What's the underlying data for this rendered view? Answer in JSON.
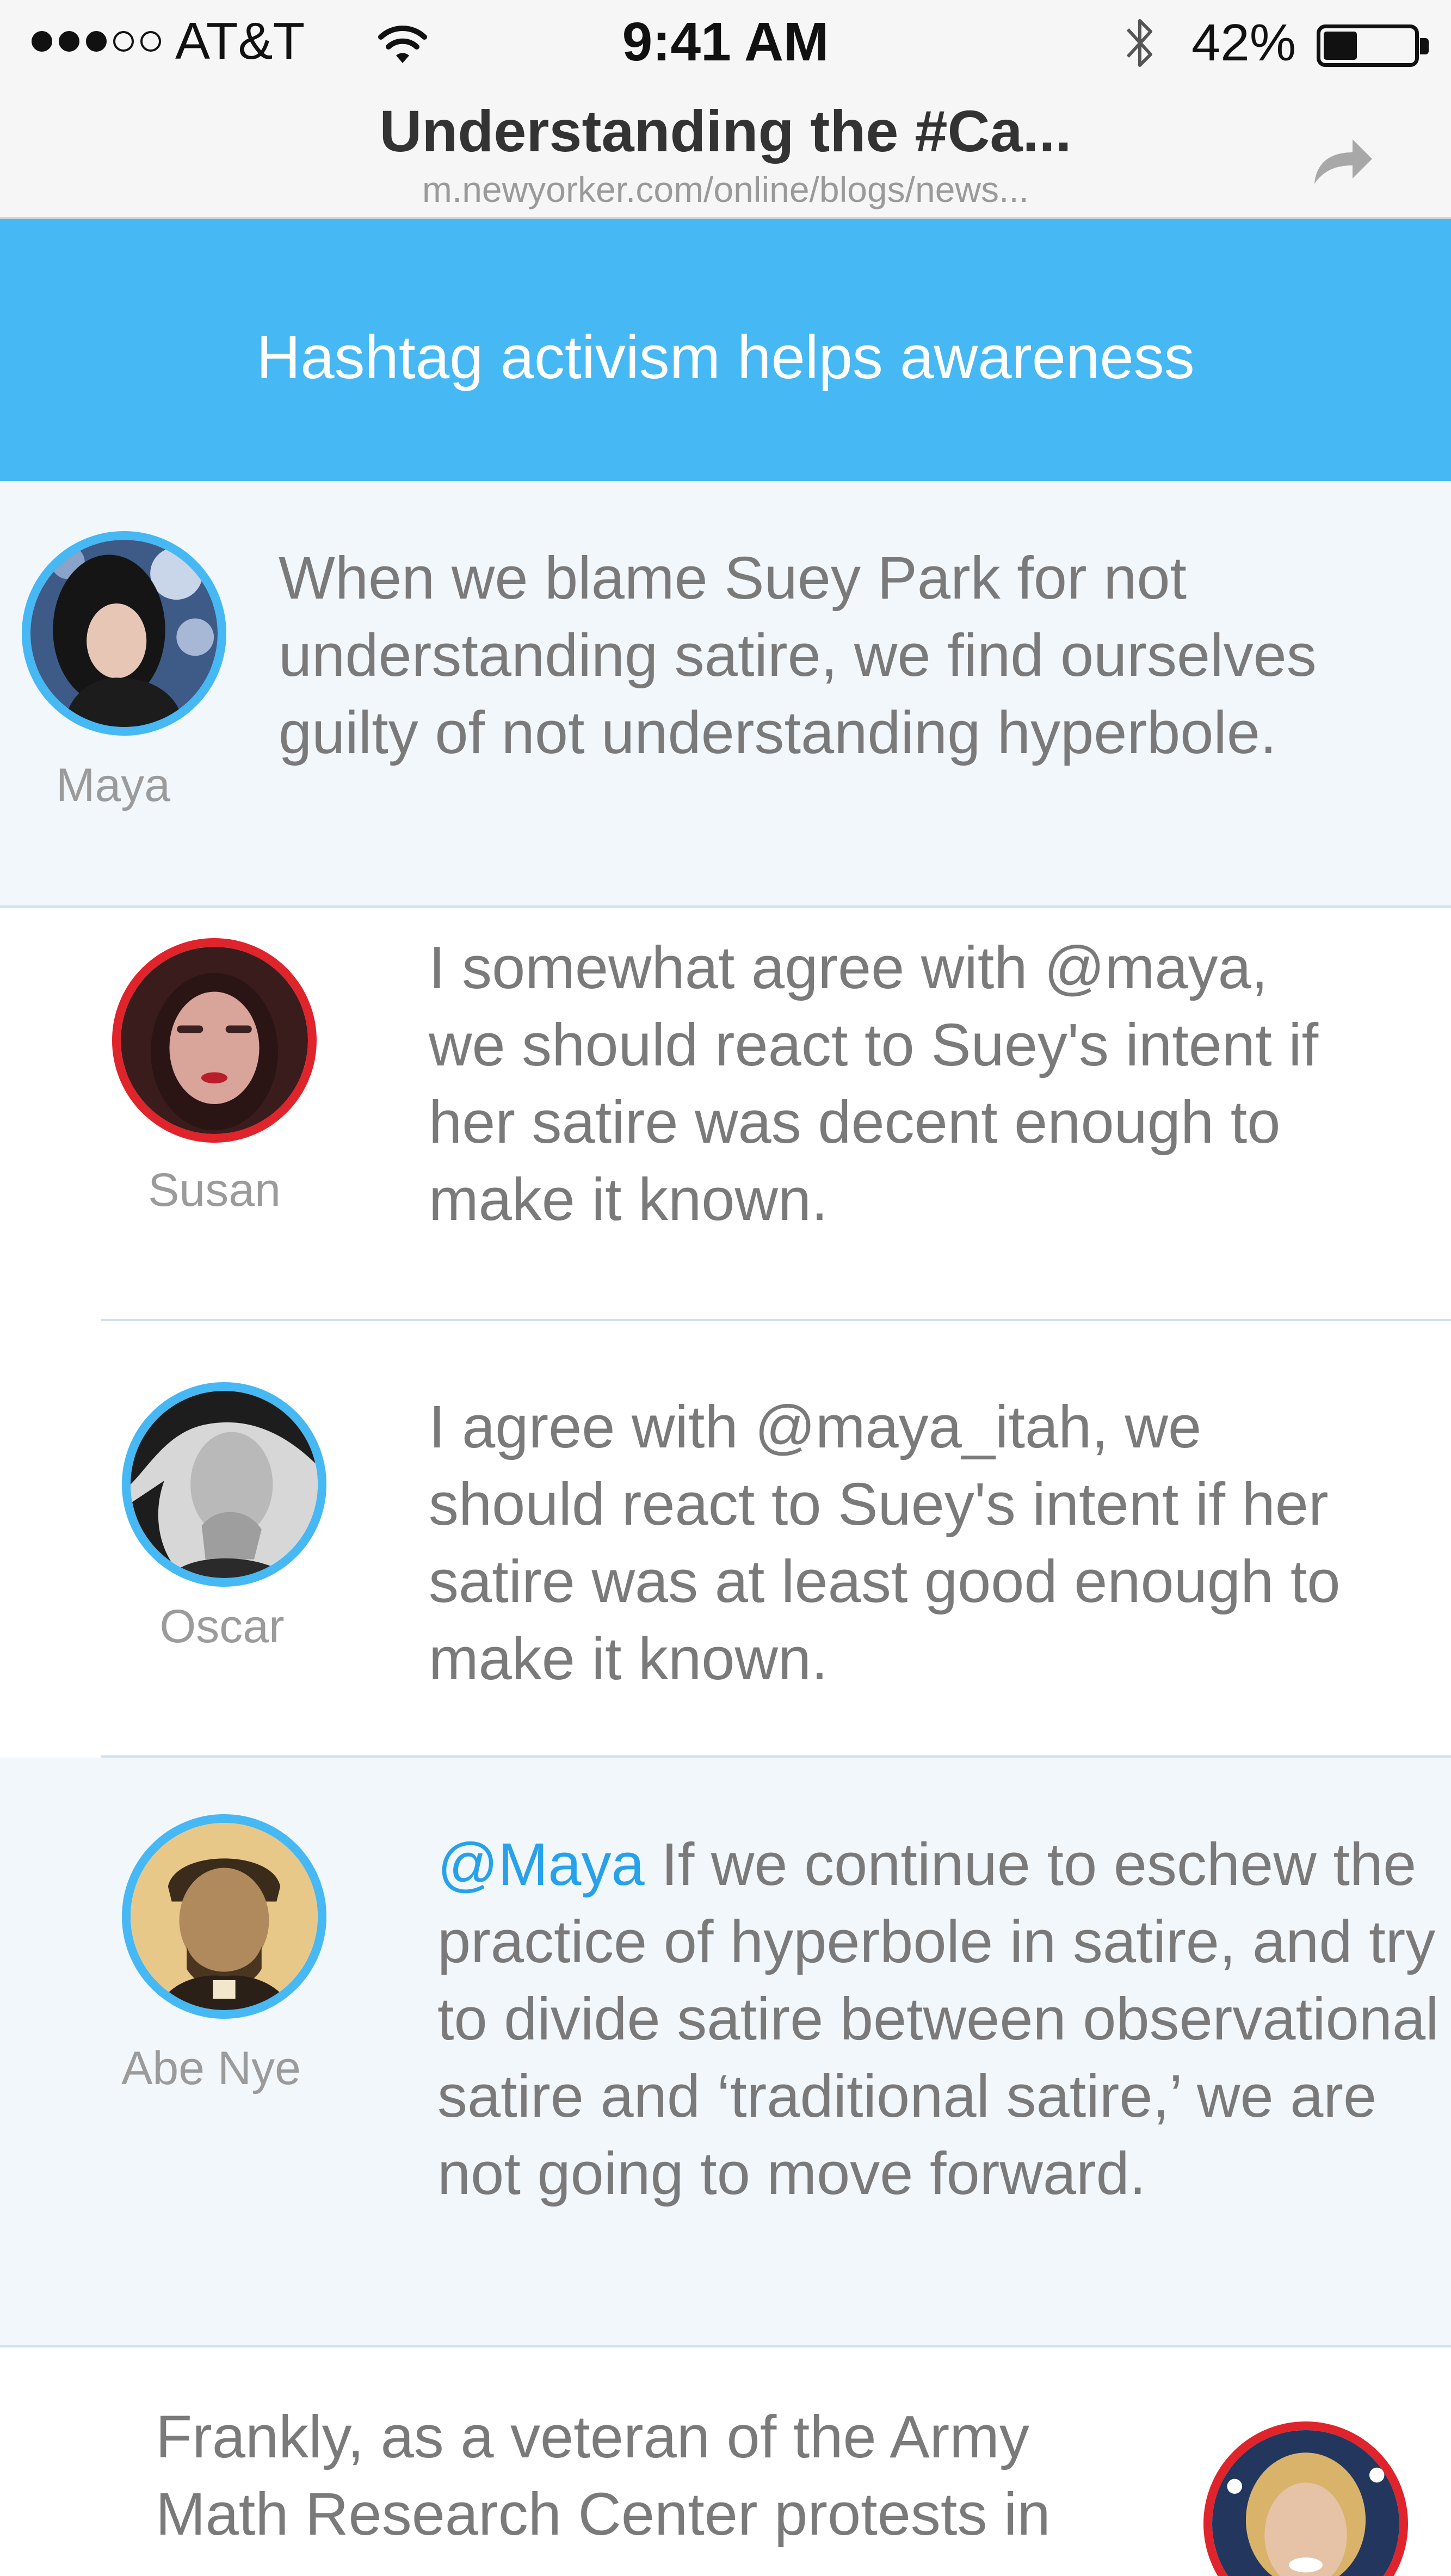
{
  "status_bar": {
    "carrier": "AT&T",
    "time": "9:41 AM",
    "battery_percent": "42%",
    "battery_level": 0.42,
    "signal_bars": 3,
    "signal_total": 5
  },
  "address_bar": {
    "title": "Understanding the #Ca...",
    "url": "m.newyorker.com/online/blogs/news..."
  },
  "topic": {
    "text": "Hashtag activism helps awareness"
  },
  "comments": [
    {
      "author": "Maya",
      "text": "When we blame Suey Park for not understanding satire, we find ourselves guilty of not understanding hyperbole.",
      "avatar_ring": "#46b8f3"
    },
    {
      "author": "Susan",
      "text": "I somewhat agree with @maya, we should react to Suey's intent if her satire was decent enough to make it known.",
      "avatar_ring": "#e0242b"
    },
    {
      "author": "Oscar",
      "text": "I agree with @maya_itah, we should react to Suey's intent if her satire was at least good enough to make it known.",
      "avatar_ring": "#46b8f3"
    },
    {
      "author": "Abe Nye",
      "mention": "@Maya",
      "text": " If we continue to eschew  the practice of hyperbole in satire, and try to divide satire between observational satire and ‘traditional satire,’ we are not going to move forward.",
      "avatar_ring": "#46b8f3"
    },
    {
      "text": "Frankly, as a veteran of the Army Math Research Center protests in",
      "avatar_ring": "#e0242b"
    }
  ],
  "colors": {
    "accent_blue": "#46b8f3",
    "mention_blue": "#27a1ea",
    "ring_red": "#e0242b",
    "highlight_bg": "#f2f7fb"
  }
}
